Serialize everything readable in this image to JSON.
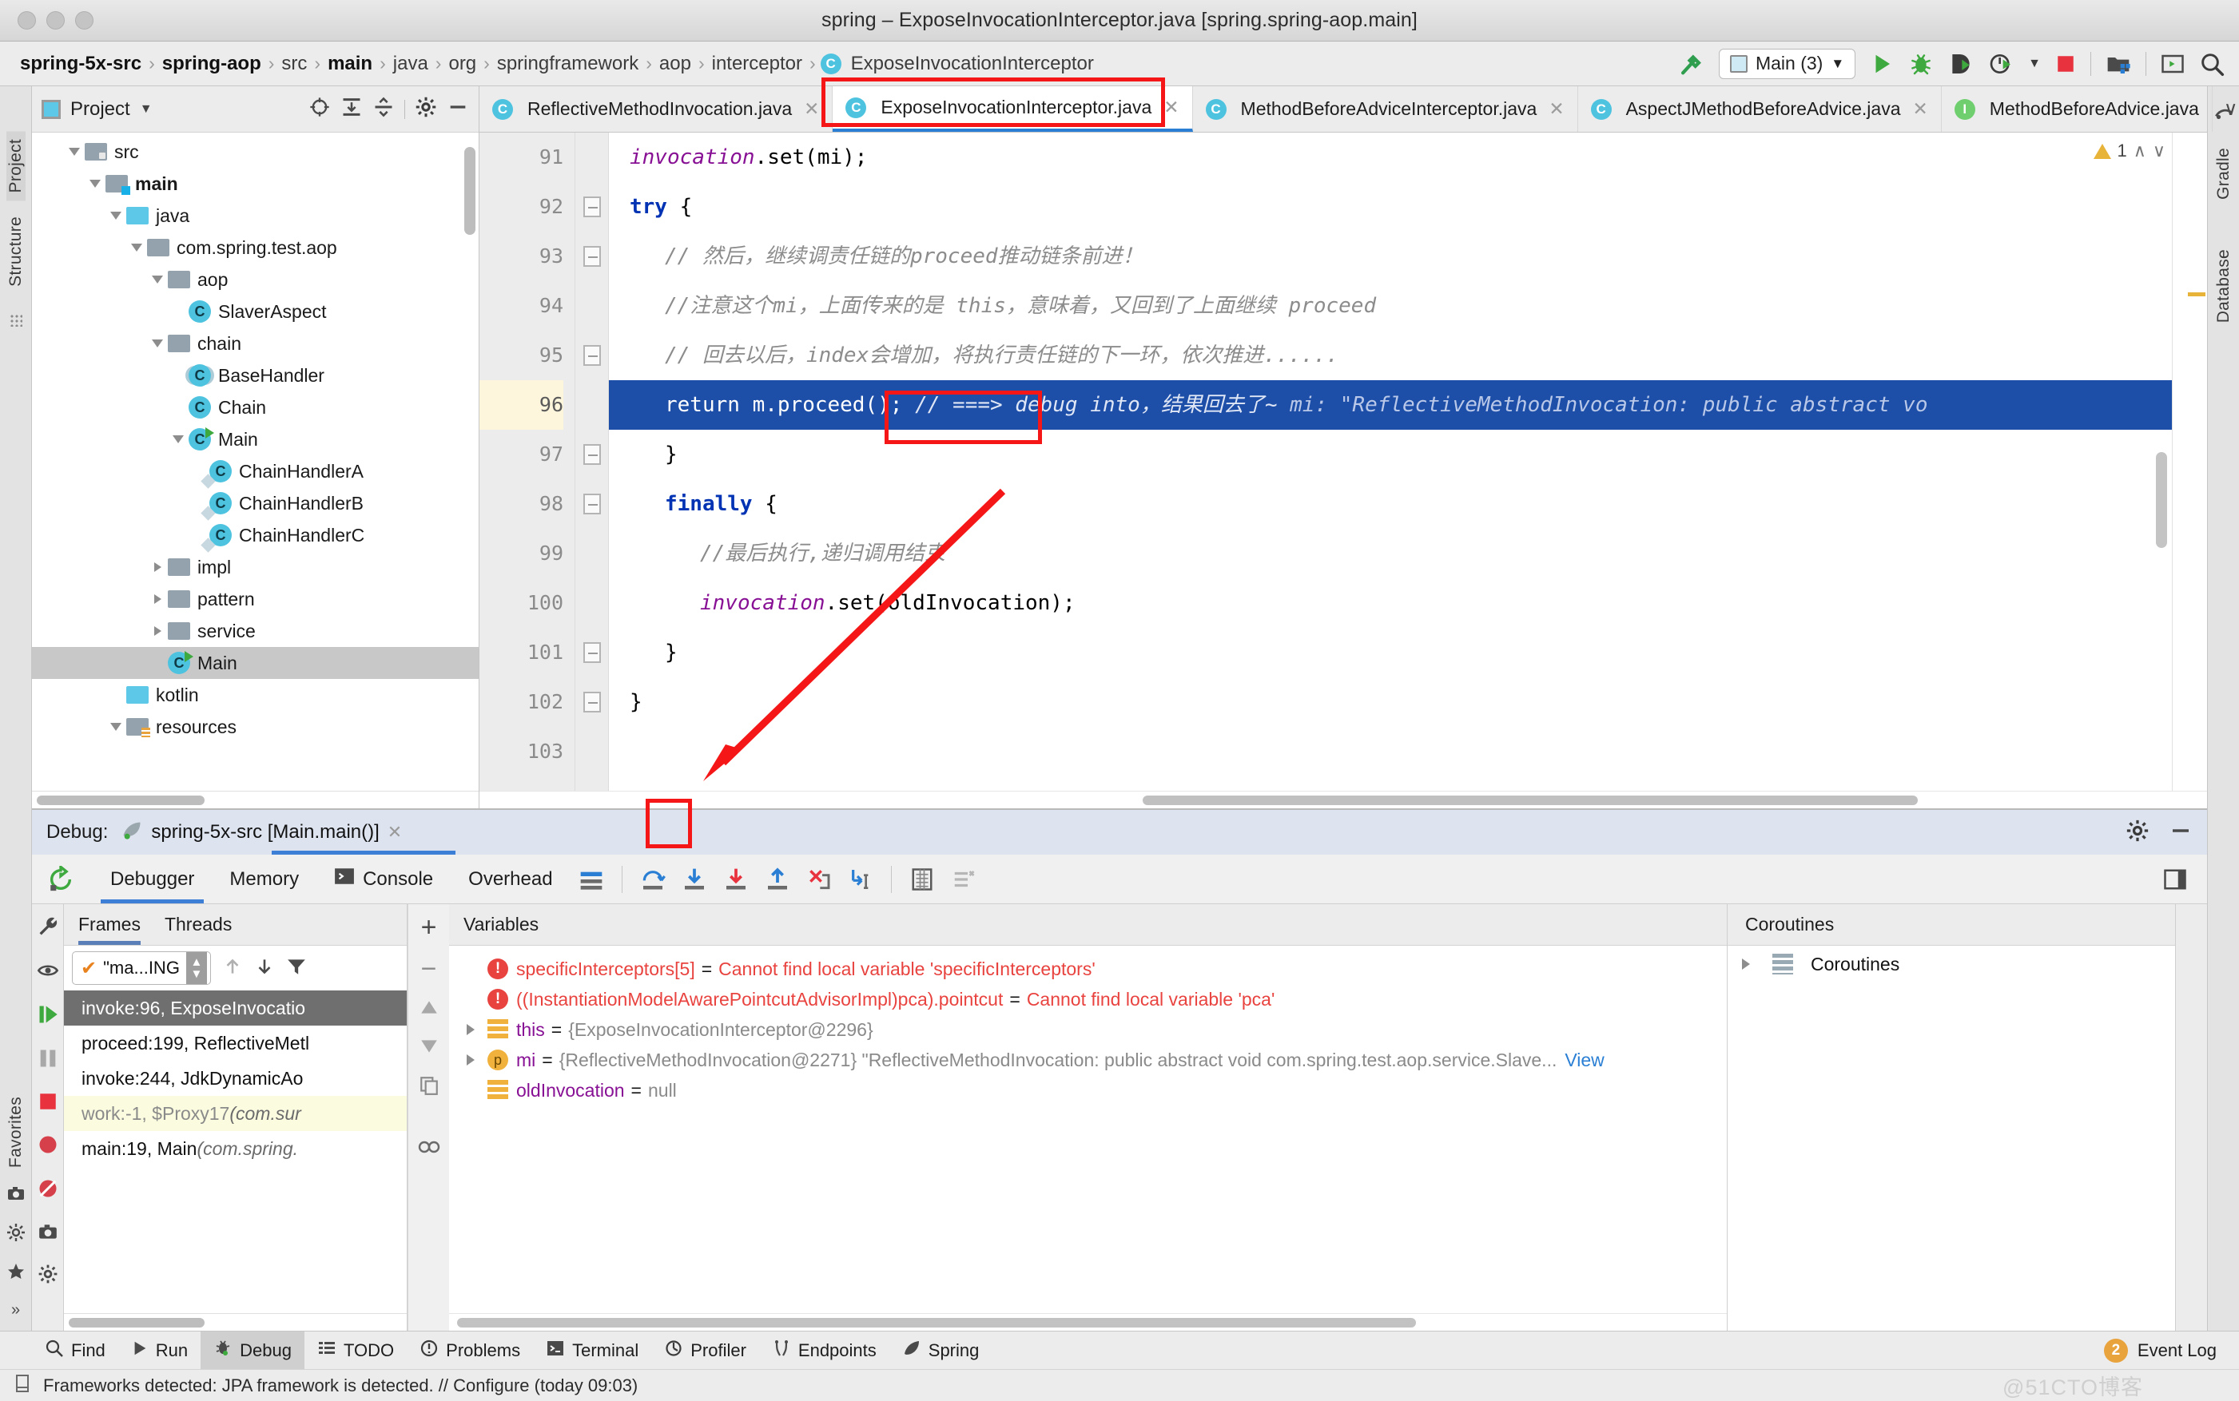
{
  "window": {
    "title": "spring – ExposeInvocationInterceptor.java [spring.spring-aop.main]"
  },
  "breadcrumb": {
    "items": [
      {
        "label": "spring-5x-src",
        "bold": true
      },
      {
        "label": "spring-aop",
        "bold": true
      },
      {
        "label": "src",
        "bold": false
      },
      {
        "label": "main",
        "bold": true
      },
      {
        "label": "java",
        "bold": false
      },
      {
        "label": "org",
        "bold": false
      },
      {
        "label": "springframework",
        "bold": false
      },
      {
        "label": "aop",
        "bold": false
      },
      {
        "label": "interceptor",
        "bold": false
      },
      {
        "label": "ExposeInvocationInterceptor",
        "bold": false,
        "icon": "class-badge"
      }
    ],
    "separator": "›"
  },
  "navbar_toolbar": {
    "build_icon": "hammer-icon",
    "run_config": {
      "label": "Main (3)",
      "icon": "run-config-icon",
      "chevron": "▼"
    },
    "run_icon": "run-icon",
    "debug_icon": "debug-icon",
    "run_coverage_icon": "run-with-coverage-icon",
    "profile_icon": "profile-icon",
    "profile_chevron": "▼",
    "stop_icon": "stop-icon",
    "project_structure_icon": "project-structure-icon",
    "terminal_icon": "terminal-icon",
    "search_icon": "search-everywhere-icon"
  },
  "left_strip": {
    "tabs": [
      "Project",
      "Structure"
    ]
  },
  "right_strip": {
    "tabs": [
      "Gradle",
      "Database"
    ]
  },
  "project_pane": {
    "header": {
      "title": "Project",
      "chevron": "▼",
      "icons": [
        "locate-icon",
        "expand-all-icon",
        "collapse-all-icon",
        "gear-icon",
        "hide-icon"
      ]
    },
    "tree": [
      {
        "label": "src",
        "depth": 1,
        "type": "folder-src",
        "arrow": "open",
        "bold": false
      },
      {
        "label": "main",
        "depth": 2,
        "type": "folder-main",
        "arrow": "open",
        "bold": true
      },
      {
        "label": "java",
        "depth": 3,
        "type": "folder-blue",
        "arrow": "open",
        "bold": false
      },
      {
        "label": "com.spring.test.aop",
        "depth": 4,
        "type": "folder-pkg",
        "arrow": "open",
        "bold": false
      },
      {
        "label": "aop",
        "depth": 5,
        "type": "folder-pkg",
        "arrow": "open",
        "bold": false
      },
      {
        "label": "SlaverAspect",
        "depth": 6,
        "type": "class",
        "arrow": "none",
        "bold": false
      },
      {
        "label": "chain",
        "depth": 5,
        "type": "folder-pkg",
        "arrow": "open",
        "bold": false
      },
      {
        "label": "BaseHandler",
        "depth": 6,
        "type": "class-abstract",
        "arrow": "none",
        "bold": false
      },
      {
        "label": "Chain",
        "depth": 6,
        "type": "class",
        "arrow": "none",
        "bold": false
      },
      {
        "label": "Main",
        "depth": 6,
        "type": "class-runnable",
        "arrow": "open",
        "bold": false
      },
      {
        "label": "ChainHandlerA",
        "depth": 7,
        "type": "class-impl",
        "arrow": "none",
        "bold": false
      },
      {
        "label": "ChainHandlerB",
        "depth": 7,
        "type": "class-impl",
        "arrow": "none",
        "bold": false
      },
      {
        "label": "ChainHandlerC",
        "depth": 7,
        "type": "class-impl",
        "arrow": "none",
        "bold": false
      },
      {
        "label": "impl",
        "depth": 5,
        "type": "folder-pkg",
        "arrow": "closed",
        "bold": false
      },
      {
        "label": "pattern",
        "depth": 5,
        "type": "folder-pkg",
        "arrow": "closed",
        "bold": false
      },
      {
        "label": "service",
        "depth": 5,
        "type": "folder-pkg",
        "arrow": "closed",
        "bold": false
      },
      {
        "label": "Main",
        "depth": 5,
        "type": "class-runnable",
        "arrow": "none",
        "bold": false,
        "selected": true
      },
      {
        "label": "kotlin",
        "depth": 3,
        "type": "folder-blue",
        "arrow": "none",
        "bold": false
      },
      {
        "label": "resources",
        "depth": 3,
        "type": "folder-res",
        "arrow": "open",
        "bold": false
      }
    ]
  },
  "editor": {
    "tabs": [
      {
        "label": "ReflectiveMethodInvocation.java",
        "icon": "class-badge",
        "active": false,
        "closable": true
      },
      {
        "label": "ExposeInvocationInterceptor.java",
        "icon": "class-badge",
        "active": true,
        "closable": true
      },
      {
        "label": "MethodBeforeAdviceInterceptor.java",
        "icon": "class-badge",
        "active": false,
        "closable": true
      },
      {
        "label": "AspectJMethodBeforeAdvice.java",
        "icon": "class-badge",
        "active": false,
        "closable": true
      },
      {
        "label": "MethodBeforeAdvice.java",
        "icon": "interface-badge",
        "active": false,
        "closable": false
      }
    ],
    "tab_overflow_chevron": "∨",
    "warning_count": "1",
    "warning_up": "∧",
    "warning_down": "∨",
    "lines": [
      {
        "num": "91",
        "fold": "none",
        "current": false,
        "parts": [
          {
            "t": "field",
            "s": "invocation"
          },
          {
            "t": "plain",
            "s": ".set(mi);"
          }
        ]
      },
      {
        "num": "92",
        "fold": "minus",
        "current": false,
        "parts": [
          {
            "t": "kw",
            "s": "try"
          },
          {
            "t": "plain",
            "s": " {"
          }
        ]
      },
      {
        "num": "93",
        "fold": "minus",
        "current": false,
        "indent": true,
        "parts": [
          {
            "t": "cmt",
            "s": "// 然后，继续调责任链的proceed推动链条前进！"
          }
        ]
      },
      {
        "num": "94",
        "fold": "none",
        "current": false,
        "indent": true,
        "parts": [
          {
            "t": "cmt",
            "s": "//注意这个mi，上面传来的是 this，意味着，又回到了上面继续 proceed"
          }
        ]
      },
      {
        "num": "95",
        "fold": "minus",
        "current": false,
        "indent": true,
        "parts": [
          {
            "t": "cmt",
            "s": "// 回去以后，index会增加，将执行责任链的下一环，依次推进......"
          }
        ]
      },
      {
        "num": "96",
        "fold": "none",
        "current": true,
        "highlight": true,
        "indent": true,
        "parts": [
          {
            "t": "plain",
            "s": "return m"
          },
          {
            "t": "plain",
            "s": ".proceed();"
          },
          {
            "t": "cmt",
            "s": "  // ===> debug into，结果回去了~"
          },
          {
            "t": "dim",
            "s": "  mi: \"ReflectiveMethodInvocation: public abstract vo"
          }
        ]
      },
      {
        "num": "97",
        "fold": "minus",
        "current": false,
        "indent": true,
        "parts": [
          {
            "t": "plain",
            "s": "}"
          }
        ]
      },
      {
        "num": "98",
        "fold": "minus",
        "current": false,
        "indent": true,
        "parts": [
          {
            "t": "kw",
            "s": "finally"
          },
          {
            "t": "plain",
            "s": " {"
          }
        ]
      },
      {
        "num": "99",
        "fold": "none",
        "current": false,
        "indent2": true,
        "parts": [
          {
            "t": "cmt",
            "s": "//最后执行,递归调用结束"
          }
        ]
      },
      {
        "num": "100",
        "fold": "none",
        "current": false,
        "indent2": true,
        "parts": [
          {
            "t": "field",
            "s": "invocation"
          },
          {
            "t": "plain",
            "s": ".set(oldInvocation);"
          }
        ]
      },
      {
        "num": "101",
        "fold": "minus",
        "current": false,
        "indent": true,
        "parts": [
          {
            "t": "plain",
            "s": "}"
          }
        ]
      },
      {
        "num": "102",
        "fold": "minus",
        "current": false,
        "parts": [
          {
            "t": "plain",
            "s": "}"
          }
        ]
      },
      {
        "num": "103",
        "fold": "none",
        "current": false,
        "parts": []
      }
    ]
  },
  "debug": {
    "label": "Debug:",
    "session": "spring-5x-src [Main.main()]",
    "session_icon": "spring-leaf-icon",
    "session_close": "✕",
    "settings_icon": "gear-icon",
    "hide_icon": "hide-icon",
    "rerun_icon": "rerun-icon",
    "tabs": [
      {
        "label": "Debugger",
        "active": true
      },
      {
        "label": "Memory",
        "active": false
      },
      {
        "label": "Console",
        "active": false,
        "icon": "console-icon"
      },
      {
        "label": "Overhead",
        "active": false
      }
    ],
    "step_buttons": [
      {
        "name": "show-execution-point-icon",
        "label": ""
      },
      {
        "name": "step-over-icon",
        "label": ""
      },
      {
        "name": "step-into-icon",
        "label": "",
        "highlighted": true
      },
      {
        "name": "force-step-into-icon",
        "label": ""
      },
      {
        "name": "step-out-icon",
        "label": ""
      },
      {
        "name": "drop-frame-icon",
        "label": ""
      },
      {
        "name": "run-to-cursor-icon",
        "label": ""
      },
      {
        "name": "evaluate-expression-icon",
        "label": ""
      },
      {
        "name": "mute-breakpoints-icon",
        "label": ""
      }
    ],
    "layout_icon": "layout-settings-icon",
    "side_icons": [
      "wrench-icon",
      "watch-eye-icon",
      "resume-icon",
      "pause-icon",
      "stop-icon",
      "breakpoint-icon",
      "mute-breakpoints-icon",
      "camera-icon",
      "settings-icon",
      "favorites-star-icon"
    ],
    "frames": {
      "tabs": [
        {
          "label": "Frames",
          "active": true
        },
        {
          "label": "Threads",
          "active": false
        }
      ],
      "thread_selector": {
        "value": "\"ma...ING",
        "check": "✔"
      },
      "nav_icons": [
        "arrow-up-icon",
        "arrow-down-icon",
        "filter-icon"
      ],
      "side_icons": [
        "add-icon",
        "remove-icon",
        "move-up-icon",
        "move-down-icon",
        "copy-icon",
        "watches-icon"
      ],
      "rows": [
        {
          "text": "invoke:96, ExposeInvocatio",
          "state": "selected"
        },
        {
          "text": "proceed:199, ReflectiveMetl",
          "state": "normal"
        },
        {
          "text": "invoke:244, JdkDynamicAo",
          "state": "normal"
        },
        {
          "text": "work:-1, $Proxy17 ",
          "italic": "(com.sur",
          "state": "library"
        },
        {
          "text": "main:19, Main ",
          "italic": "(com.spring.",
          "state": "normal"
        }
      ]
    },
    "variables": {
      "header": "Variables",
      "rows": [
        {
          "expand": false,
          "icon": "error-icon",
          "name": "specificInterceptors[5]",
          "name_class": "err",
          "eq": "=",
          "value": "Cannot find local variable 'specificInterceptors'",
          "value_class": "err"
        },
        {
          "expand": false,
          "icon": "error-icon",
          "name": "((InstantiationModelAwarePointcutAdvisorImpl)pca).pointcut",
          "name_class": "err",
          "eq": "=",
          "value": "Cannot find local variable 'pca'",
          "value_class": "err"
        },
        {
          "expand": true,
          "icon": "field-icon",
          "name": "this",
          "name_class": "",
          "eq": "=",
          "value": "{ExposeInvocationInterceptor@2296}",
          "value_class": ""
        },
        {
          "expand": true,
          "icon": "param-icon",
          "name": "mi",
          "name_class": "",
          "eq": "=",
          "value": "{ReflectiveMethodInvocation@2271} \"ReflectiveMethodInvocation: public abstract void com.spring.test.aop.service.Slave...",
          "value_class": "",
          "link": "View"
        },
        {
          "expand": false,
          "icon": "field-icon",
          "name": "oldInvocation",
          "name_class": "",
          "eq": "=",
          "value": "null",
          "value_class": ""
        }
      ]
    },
    "coroutines": {
      "header": "Coroutines",
      "rows": [
        {
          "label": "Coroutines",
          "icon": "coroutines-icon",
          "expand": true
        }
      ]
    }
  },
  "bottom_toolbar": {
    "items": [
      {
        "label": "Find",
        "icon": "search-icon",
        "active": false
      },
      {
        "label": "Run",
        "icon": "run-icon",
        "active": false
      },
      {
        "label": "Debug",
        "icon": "debug-icon",
        "active": true
      },
      {
        "label": "TODO",
        "icon": "todo-icon",
        "active": false
      },
      {
        "label": "Problems",
        "icon": "problems-icon",
        "active": false
      },
      {
        "label": "Terminal",
        "icon": "terminal-icon",
        "active": false
      },
      {
        "label": "Profiler",
        "icon": "profiler-icon",
        "active": false
      },
      {
        "label": "Endpoints",
        "icon": "endpoints-icon",
        "active": false
      },
      {
        "label": "Spring",
        "icon": "spring-leaf-icon",
        "active": false
      }
    ],
    "event_log": {
      "label": "Event Log",
      "count": "2",
      "icon": "event-log-icon"
    }
  },
  "statusbar": {
    "icon": "notification-icon",
    "text": "Frameworks detected: JPA framework is detected. // Configure (today 09:03)",
    "watermark": "@51CTO博客"
  },
  "colors": {
    "accent_blue": "#2a7fd4",
    "selection_blue": "#1d4ea8",
    "annotation_red": "#f51717",
    "keyword_blue": "#0033b3",
    "field_purple": "#871094",
    "comment_gray": "#8c8c8c",
    "error_red": "#e8433f",
    "class_badge": "#4ec3e0",
    "interface_badge": "#6fcf6f"
  }
}
